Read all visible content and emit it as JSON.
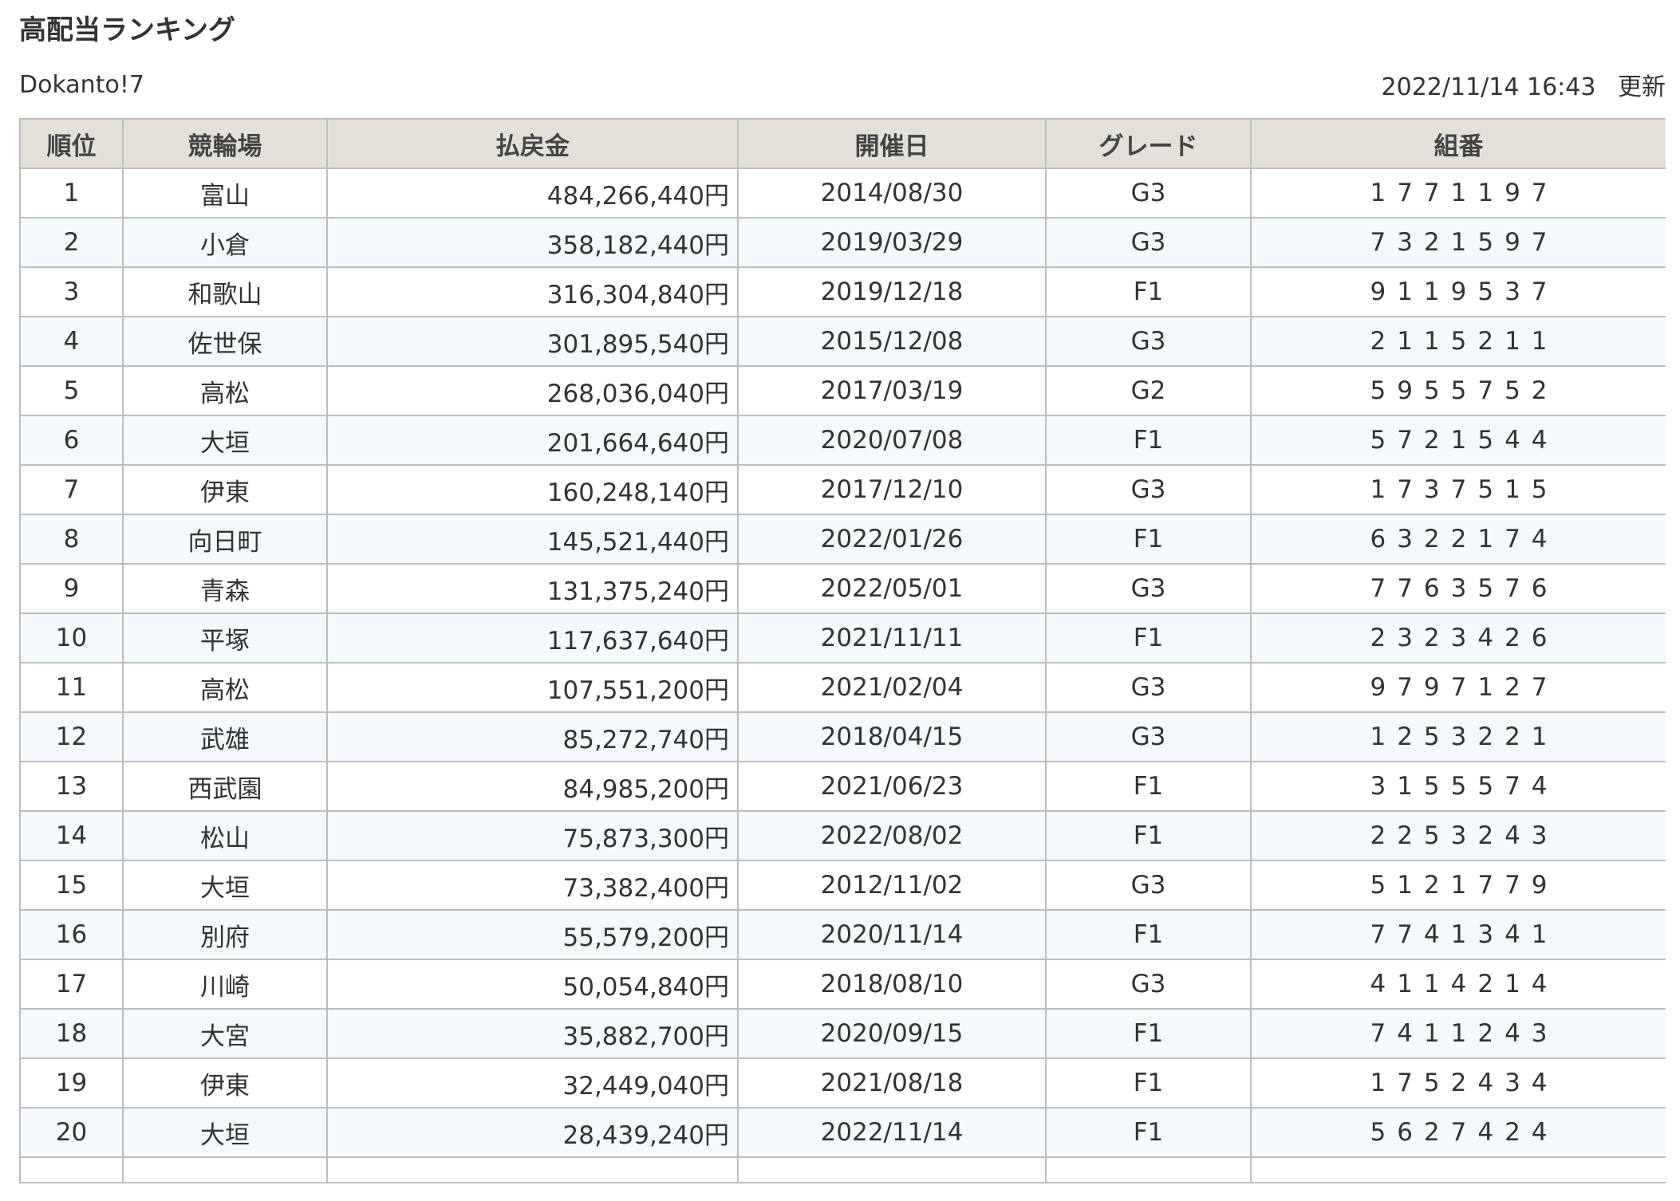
{
  "page": {
    "title": "高配当ランキング",
    "site_name": "Dokanto!7",
    "updated_datetime": "2022/11/14 16:43",
    "updated_label": "更新"
  },
  "table": {
    "headers": [
      "順位",
      "競輪場",
      "払戻金",
      "開催日",
      "グレード",
      "組番"
    ],
    "rows": [
      {
        "rank": "1",
        "venue": "富山",
        "payout": "484,266,440円",
        "date": "2014/08/30",
        "grade": "G3",
        "combo": "1771197"
      },
      {
        "rank": "2",
        "venue": "小倉",
        "payout": "358,182,440円",
        "date": "2019/03/29",
        "grade": "G3",
        "combo": "7321597"
      },
      {
        "rank": "3",
        "venue": "和歌山",
        "payout": "316,304,840円",
        "date": "2019/12/18",
        "grade": "F1",
        "combo": "9119537"
      },
      {
        "rank": "4",
        "venue": "佐世保",
        "payout": "301,895,540円",
        "date": "2015/12/08",
        "grade": "G3",
        "combo": "2115211"
      },
      {
        "rank": "5",
        "venue": "高松",
        "payout": "268,036,040円",
        "date": "2017/03/19",
        "grade": "G2",
        "combo": "5955752"
      },
      {
        "rank": "6",
        "venue": "大垣",
        "payout": "201,664,640円",
        "date": "2020/07/08",
        "grade": "F1",
        "combo": "5721544"
      },
      {
        "rank": "7",
        "venue": "伊東",
        "payout": "160,248,140円",
        "date": "2017/12/10",
        "grade": "G3",
        "combo": "1737515"
      },
      {
        "rank": "8",
        "venue": "向日町",
        "payout": "145,521,440円",
        "date": "2022/01/26",
        "grade": "F1",
        "combo": "6322174"
      },
      {
        "rank": "9",
        "venue": "青森",
        "payout": "131,375,240円",
        "date": "2022/05/01",
        "grade": "G3",
        "combo": "7763576"
      },
      {
        "rank": "10",
        "venue": "平塚",
        "payout": "117,637,640円",
        "date": "2021/11/11",
        "grade": "F1",
        "combo": "2323426"
      },
      {
        "rank": "11",
        "venue": "高松",
        "payout": "107,551,200円",
        "date": "2021/02/04",
        "grade": "G3",
        "combo": "9797127"
      },
      {
        "rank": "12",
        "venue": "武雄",
        "payout": "85,272,740円",
        "date": "2018/04/15",
        "grade": "G3",
        "combo": "1253221"
      },
      {
        "rank": "13",
        "venue": "西武園",
        "payout": "84,985,200円",
        "date": "2021/06/23",
        "grade": "F1",
        "combo": "3155574"
      },
      {
        "rank": "14",
        "venue": "松山",
        "payout": "75,873,300円",
        "date": "2022/08/02",
        "grade": "F1",
        "combo": "2253243"
      },
      {
        "rank": "15",
        "venue": "大垣",
        "payout": "73,382,400円",
        "date": "2012/11/02",
        "grade": "G3",
        "combo": "5121779"
      },
      {
        "rank": "16",
        "venue": "別府",
        "payout": "55,579,200円",
        "date": "2020/11/14",
        "grade": "F1",
        "combo": "7741341"
      },
      {
        "rank": "17",
        "venue": "川崎",
        "payout": "50,054,840円",
        "date": "2018/08/10",
        "grade": "G3",
        "combo": "4114214"
      },
      {
        "rank": "18",
        "venue": "大宮",
        "payout": "35,882,700円",
        "date": "2020/09/15",
        "grade": "F1",
        "combo": "7411243"
      },
      {
        "rank": "19",
        "venue": "伊東",
        "payout": "32,449,040円",
        "date": "2021/08/18",
        "grade": "F1",
        "combo": "1752434"
      },
      {
        "rank": "20",
        "venue": "大垣",
        "payout": "28,439,240円",
        "date": "2022/11/14",
        "grade": "F1",
        "combo": "5627424"
      }
    ]
  },
  "colors": {
    "header_bg": "#e2e0d9",
    "border": "#bdbdbd",
    "row_alt_bg": "#f4f9fb",
    "text": "#333333"
  }
}
